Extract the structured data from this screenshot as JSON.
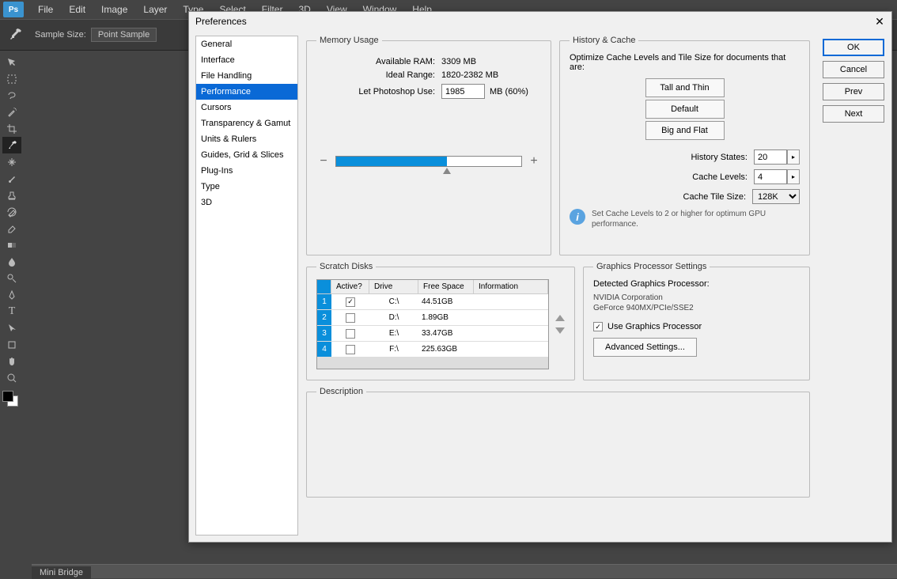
{
  "menubar": {
    "app_abbr": "Ps",
    "items": [
      "File",
      "Edit",
      "Image",
      "Layer",
      "Type",
      "Select",
      "Filter",
      "3D",
      "View",
      "Window",
      "Help"
    ]
  },
  "optionsbar": {
    "sample_size_label": "Sample Size:",
    "sample_size_value": "Point Sample"
  },
  "toolbar": {
    "tools": [
      "move",
      "marquee",
      "lasso",
      "wand",
      "crop",
      "eyedrop",
      "heal",
      "brush",
      "stamp",
      "history",
      "eraser",
      "gradient",
      "blur",
      "dodge",
      "pen",
      "text",
      "path",
      "shape",
      "hand",
      "zoom"
    ]
  },
  "bottompanel": {
    "tab": "Mini Bridge"
  },
  "dialog": {
    "title": "Preferences",
    "close": "✕",
    "sidebar": {
      "items": [
        "General",
        "Interface",
        "File Handling",
        "Performance",
        "Cursors",
        "Transparency & Gamut",
        "Units & Rulers",
        "Guides, Grid & Slices",
        "Plug-Ins",
        "Type",
        "3D"
      ],
      "selected_index": 3
    },
    "memory": {
      "legend": "Memory Usage",
      "available_label": "Available RAM:",
      "available_value": "3309 MB",
      "ideal_label": "Ideal Range:",
      "ideal_value": "1820-2382 MB",
      "let_label": "Let Photoshop Use:",
      "let_value": "1985",
      "let_suffix": "MB (60%)",
      "slider_percent": 60
    },
    "history": {
      "legend": "History & Cache",
      "desc": "Optimize Cache Levels and Tile Size for documents that are:",
      "btn_tall": "Tall and Thin",
      "btn_default": "Default",
      "btn_big": "Big and Flat",
      "states_label": "History States:",
      "states_value": "20",
      "levels_label": "Cache Levels:",
      "levels_value": "4",
      "tile_label": "Cache Tile Size:",
      "tile_value": "128K",
      "info": "Set Cache Levels to 2 or higher for optimum GPU performance."
    },
    "scratch": {
      "legend": "Scratch Disks",
      "cols": {
        "active": "Active?",
        "drive": "Drive",
        "free": "Free Space",
        "info": "Information"
      },
      "rows": [
        {
          "n": "1",
          "active": true,
          "drive": "C:\\",
          "free": "44.51GB"
        },
        {
          "n": "2",
          "active": false,
          "drive": "D:\\",
          "free": "1.89GB"
        },
        {
          "n": "3",
          "active": false,
          "drive": "E:\\",
          "free": "33.47GB"
        },
        {
          "n": "4",
          "active": false,
          "drive": "F:\\",
          "free": "225.63GB"
        }
      ]
    },
    "gpu": {
      "legend": "Graphics Processor Settings",
      "detected_label": "Detected Graphics Processor:",
      "vendor": "NVIDIA Corporation",
      "model": "GeForce 940MX/PCIe/SSE2",
      "use_label": "Use Graphics Processor",
      "use_checked": true,
      "adv_btn": "Advanced Settings..."
    },
    "description": {
      "legend": "Description"
    },
    "actions": {
      "ok": "OK",
      "cancel": "Cancel",
      "prev": "Prev",
      "next": "Next"
    }
  }
}
